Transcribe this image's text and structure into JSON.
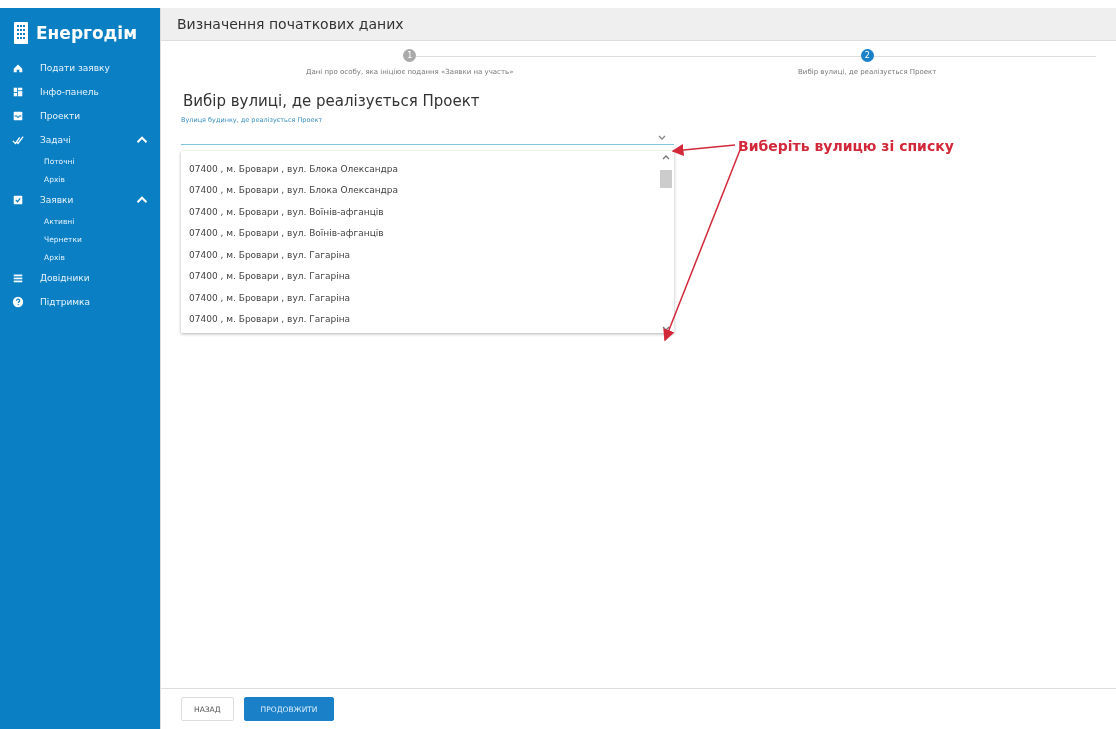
{
  "sidebar": {
    "logo": "Енергодім",
    "items": [
      {
        "kind": "main",
        "label": "Подати заявку"
      },
      {
        "kind": "main",
        "label": "Інфо-панель"
      },
      {
        "kind": "main",
        "label": "Проекти"
      },
      {
        "kind": "group",
        "label": "Задачі",
        "expanded": true,
        "children": [
          {
            "label": "Поточні"
          },
          {
            "label": "Архів"
          }
        ]
      },
      {
        "kind": "group",
        "label": "Заявки",
        "expanded": true,
        "children": [
          {
            "label": "Активні"
          },
          {
            "label": "Чернетки"
          },
          {
            "label": "Архів"
          }
        ]
      },
      {
        "kind": "main",
        "label": "Довідники"
      },
      {
        "kind": "main",
        "label": "Підтримка"
      }
    ]
  },
  "header": {
    "title": "Визначення початкових даних"
  },
  "steps": [
    {
      "number": "1",
      "label": "Дані про особу, яка ініціює подання «Заявки на участь»",
      "selected": false
    },
    {
      "number": "2",
      "label": "Вибір вулиці, де реалізується Проект",
      "selected": true
    }
  ],
  "section_title": "Вибір вулиці, де реалізується Проект",
  "street_field": {
    "label": "Вулиця будинку, де реалізується Проект",
    "expanded": true,
    "options": [
      "07400 , м. Бровари , вул. Блока Олександра",
      "07400 , м. Бровари , вул. Блока Олександра",
      "07400 , м. Бровари , вул. Воїнів-афганців",
      "07400 , м. Бровари , вул. Воїнів-афганців",
      "07400 , м. Бровари , вул. Гагаріна",
      "07400 , м. Бровари , вул. Гагаріна",
      "07400 , м. Бровари , вул. Гагаріна",
      "07400 , м. Бровари , вул. Гагаріна"
    ]
  },
  "annotation": "Виберіть вулицю зі списку",
  "buttons": [
    {
      "kind": "secondary",
      "label": "НАЗАД"
    },
    {
      "kind": "primary",
      "label": "ПРОДОВЖИТИ"
    }
  ]
}
